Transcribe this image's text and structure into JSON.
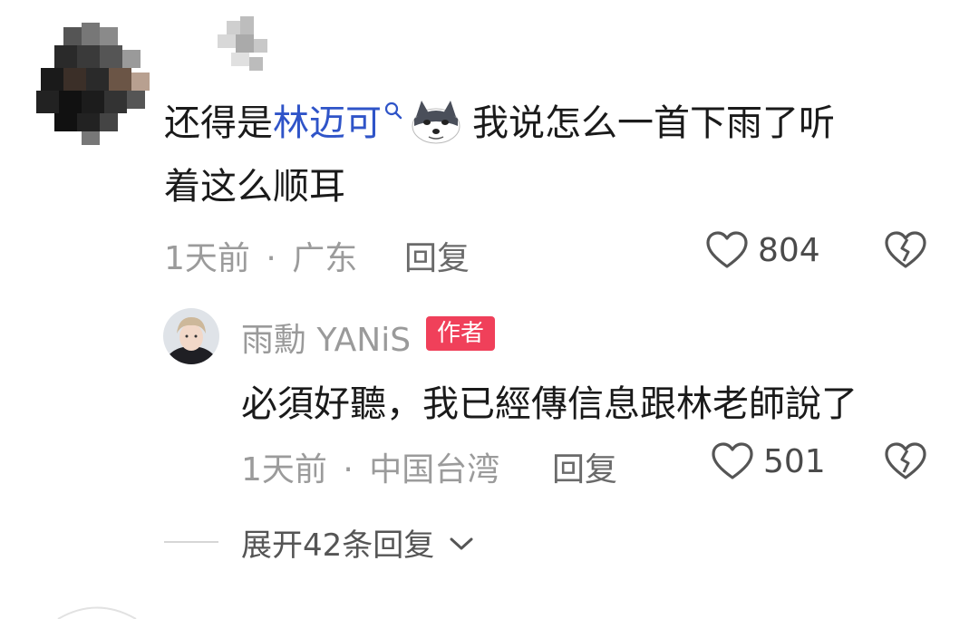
{
  "comment": {
    "text_prefix": "还得是",
    "mention": "林迈可",
    "text_suffix_line1": "我说怎么一首下雨了听",
    "text_line2": "着这么顺耳",
    "time": "1天前",
    "separator": "·",
    "location": "广东",
    "reply_label": "回复",
    "likes": "804"
  },
  "reply": {
    "author": "雨勳 YANiS",
    "badge": "作者",
    "text": "必須好聽，我已經傳信息跟林老師說了",
    "time": "1天前",
    "separator": "·",
    "location": "中国台湾",
    "reply_label": "回复",
    "likes": "501"
  },
  "expand": {
    "label": "展开42条回复"
  },
  "icons": {
    "like": "heart-outline-icon",
    "dislike": "broken-heart-icon",
    "mention": "search-icon",
    "emoji": "husky-emoji-icon",
    "expand": "chevron-down-icon"
  },
  "colors": {
    "mention": "#2f54c8",
    "badge": "#f0405a",
    "meta": "#9b9b9b"
  }
}
